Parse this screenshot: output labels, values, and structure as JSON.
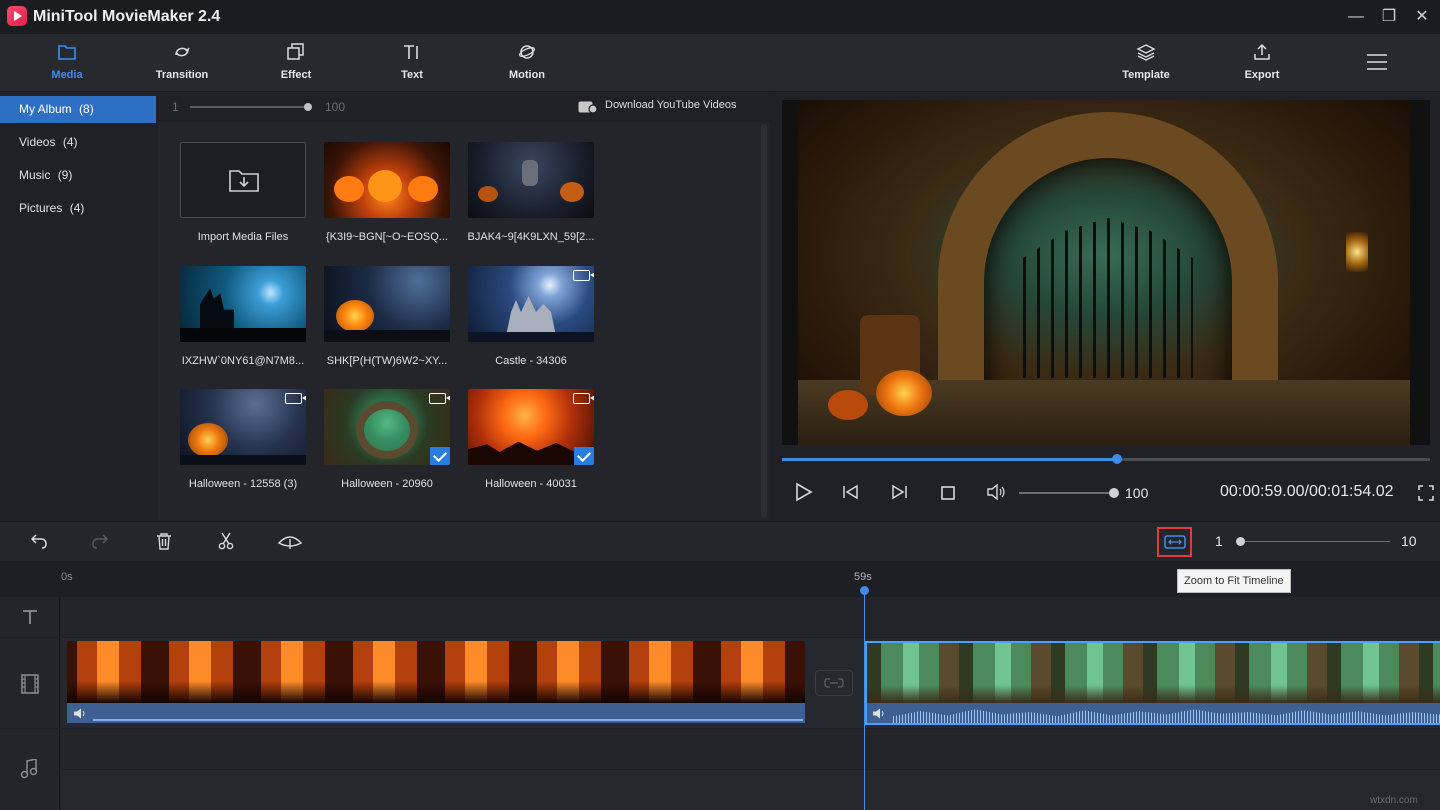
{
  "app": {
    "title": "MiniTool MovieMaker 2.4"
  },
  "window_controls": {
    "minimize": "—",
    "maximize": "❐",
    "close": "✕"
  },
  "toolbar": {
    "items": [
      {
        "label": "Media",
        "icon": "folder-icon",
        "active": true
      },
      {
        "label": "Transition",
        "icon": "transition-icon"
      },
      {
        "label": "Effect",
        "icon": "effect-icon"
      },
      {
        "label": "Text",
        "icon": "text-icon"
      },
      {
        "label": "Motion",
        "icon": "motion-icon"
      }
    ],
    "right_items": [
      {
        "label": "Template",
        "icon": "template-icon"
      },
      {
        "label": "Export",
        "icon": "export-icon"
      }
    ]
  },
  "sidebar": {
    "items": [
      {
        "label": "My Album",
        "count": "(8)",
        "active": true
      },
      {
        "label": "Videos",
        "count": "(4)"
      },
      {
        "label": "Music",
        "count": "(9)"
      },
      {
        "label": "Pictures",
        "count": "(4)"
      }
    ]
  },
  "media_bar": {
    "zoom_min": "1",
    "zoom_max": "100",
    "zoom_value_fraction": 1.0,
    "download_label": "Download YouTube Videos"
  },
  "media_items": [
    {
      "caption": "Import Media Files",
      "kind": "import"
    },
    {
      "caption": "{K3I9~BGN[~O~EOSQ...",
      "kind": "image",
      "theme": "pumpkins"
    },
    {
      "caption": "BJAK4~9[4K9LXN_59[2...",
      "kind": "image",
      "theme": "dark-pumpkins"
    },
    {
      "caption": "IXZHW`0NY61@N7M8...",
      "kind": "image",
      "theme": "witch-moon"
    },
    {
      "caption": "SHK[P(H(TW)6W2~XY...",
      "kind": "image",
      "theme": "pumpkin-night"
    },
    {
      "caption": "Castle - 34306",
      "kind": "video",
      "theme": "castle"
    },
    {
      "caption": "Halloween - 12558 (3)",
      "kind": "video",
      "theme": "pumpkin-blue"
    },
    {
      "caption": "Halloween - 20960",
      "kind": "video",
      "theme": "green-gate",
      "checked": true
    },
    {
      "caption": "Halloween - 40031",
      "kind": "video",
      "theme": "orange-moon",
      "checked": true
    }
  ],
  "player": {
    "progress_fraction": 0.5168,
    "volume_value": "100",
    "volume_fraction": 1.0,
    "time": "00:00:59.00/00:01:54.02"
  },
  "timeline": {
    "zoom_min": "1",
    "zoom_max": "10",
    "zoom_fraction": 0.0,
    "tooltip": "Zoom to Fit Timeline",
    "ruler": {
      "start": "0s",
      "mark": "59s"
    }
  },
  "colors": {
    "accent": "#3d8eea",
    "highlight_border": "#e03a3a",
    "selection": "#2c6fc4"
  },
  "watermark": "wtxdn.com"
}
